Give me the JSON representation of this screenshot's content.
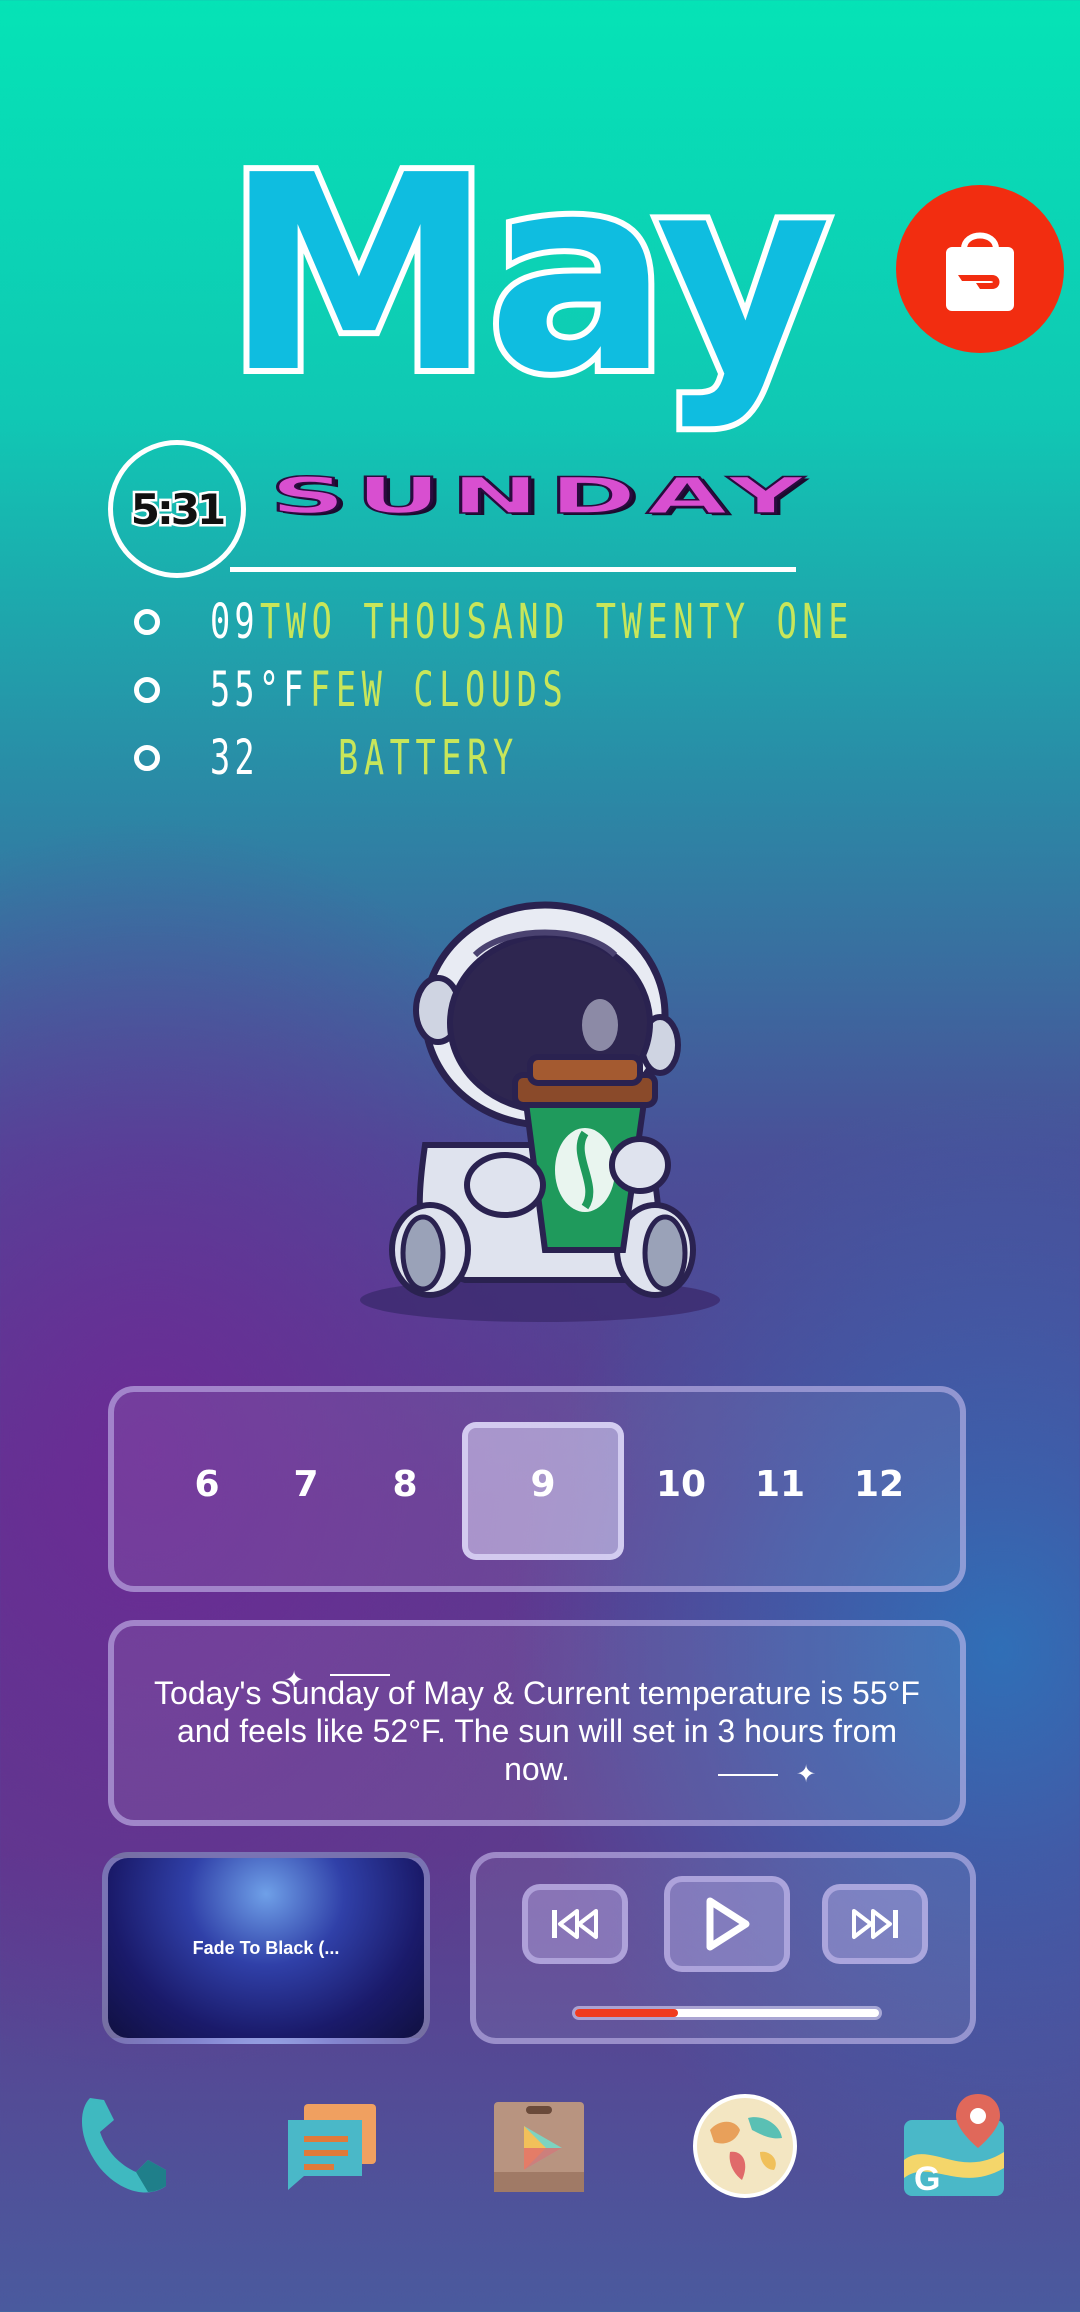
{
  "header": {
    "month": "May",
    "time": "5:31",
    "weekday": "SUNDAY"
  },
  "info": [
    {
      "num": "09",
      "text": "TWO THOUSAND TWENTY ONE"
    },
    {
      "num": "55°F",
      "text": "FEW CLOUDS"
    },
    {
      "num": "32",
      "text": "BATTERY"
    }
  ],
  "dates": {
    "items": [
      "6",
      "7",
      "8",
      "9",
      "10",
      "11",
      "12"
    ],
    "selected": "9"
  },
  "message": "Today's Sunday of May & Current temperature is 55°F and feels like 52°F. The sun will set in 3 hours from now.",
  "media": {
    "title": "Fade To Black (...",
    "progress": 0.34
  },
  "colors": {
    "accent_red": "#f03a1e",
    "month_blue": "#0fbde0",
    "weekday_magenta": "#d84fd0",
    "info_yellow": "#c8e65a"
  },
  "dock": [
    "phone-icon",
    "messages-icon",
    "play-store-icon",
    "globe-icon",
    "maps-icon"
  ]
}
